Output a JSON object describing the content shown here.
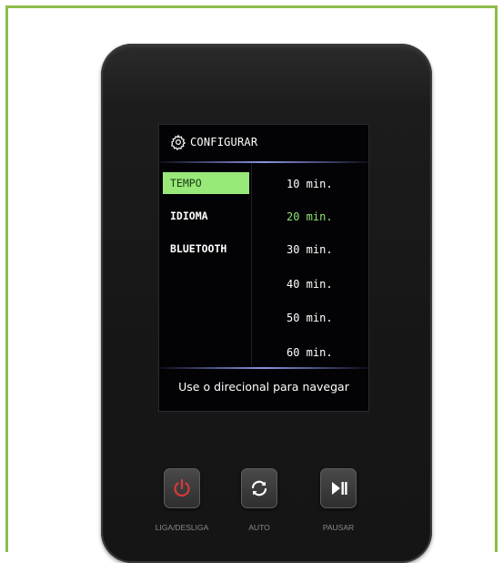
{
  "screen": {
    "header_title": "CONFIGURAR",
    "header_icon": "gear-icon",
    "menu": [
      {
        "label": "TEMPO",
        "selected": true
      },
      {
        "label": "IDIOMA",
        "selected": false
      },
      {
        "label": "BLUETOOTH",
        "selected": false
      }
    ],
    "options": [
      {
        "label": "10 min.",
        "active": false
      },
      {
        "label": "20 min.",
        "active": true
      },
      {
        "label": "30 min.",
        "active": false
      },
      {
        "label": "40 min.",
        "active": false
      },
      {
        "label": "50 min.",
        "active": false
      },
      {
        "label": "60 min.",
        "active": false
      }
    ],
    "footer_hint": "Use o direcional para navegar"
  },
  "buttons": [
    {
      "label": "LIGA/DESLIGA",
      "icon": "power-icon",
      "icon_color": "#d9383a"
    },
    {
      "label": "AUTO",
      "icon": "refresh-icon",
      "icon_color": "#ffffff"
    },
    {
      "label": "PAUSAR",
      "icon": "play-pause-icon",
      "icon_color": "#ffffff"
    }
  ],
  "colors": {
    "frame_border": "#8dbb4b",
    "selected_menu_bg": "#98e87a",
    "active_option": "#8fe46e",
    "device_body": "#1c1c1c"
  }
}
